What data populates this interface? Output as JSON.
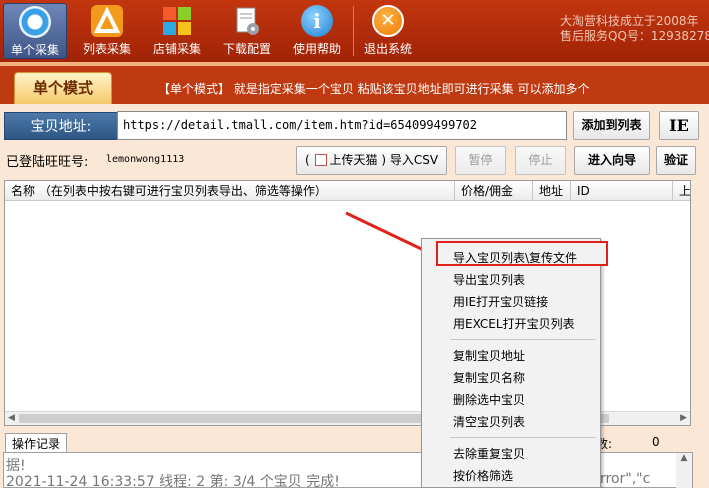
{
  "toolbar": {
    "items": [
      {
        "label": "单个采集",
        "icon": "single-collect-icon",
        "active": true
      },
      {
        "label": "列表采集",
        "icon": "list-collect-icon"
      },
      {
        "label": "店铺采集",
        "icon": "shop-collect-icon"
      },
      {
        "label": "下载配置",
        "icon": "download-config-icon"
      },
      {
        "label": "使用帮助",
        "icon": "help-icon"
      },
      {
        "label": "退出系统",
        "icon": "exit-icon"
      }
    ],
    "brand_line1": "大淘营科技成立于2008年",
    "brand_line2": "售后服务QQ号：12938278"
  },
  "mode": {
    "tab_label": "单个模式",
    "description": "【单个模式】 就是指定采集一个宝贝 粘贴该宝贝地址即可进行采集 可以添加多个"
  },
  "url_row": {
    "label": "宝贝地址:",
    "value": "https://detail.tmall.com/item.htm?id=654099499702",
    "add_button": "添加到列表",
    "ie_button": "IE"
  },
  "login_row": {
    "label": "已登陆旺旺号:",
    "value": "lemonwong1113",
    "upload_prefix": "(",
    "upload_label": "上传天猫",
    "upload_suffix": ")",
    "import_csv": "导入CSV",
    "pause": "暂停",
    "stop": "停止",
    "wizard": "进入向导",
    "verify": "验证"
  },
  "table": {
    "columns": [
      "名称  （在列表中按右键可进行宝贝列表导出、筛选等操作）",
      "价格/佣金",
      "地址",
      "ID",
      "上传"
    ]
  },
  "context_menu": {
    "group1": [
      "导入宝贝列表\\复传文件",
      "导出宝贝列表",
      "用IE打开宝贝链接",
      "用EXCEL打开宝贝列表"
    ],
    "group2": [
      "复制宝贝地址",
      "复制宝贝名称",
      "删除选中宝贝",
      "清空宝贝列表"
    ],
    "group3": [
      "去除重复宝贝",
      "按价格筛选"
    ]
  },
  "log": {
    "tab": "操作记录",
    "count_label": "数:",
    "count_value": "0",
    "line1": "据!",
    "line2": "2021-11-24 16:33:57 线程: 2 第: 3/4 个宝贝 完成!",
    "tail": "rror\",\"c"
  },
  "colors": {
    "toolbar": "#b12c0a",
    "accent_blue": "#2d5684",
    "highlight_red": "#e1221b"
  }
}
